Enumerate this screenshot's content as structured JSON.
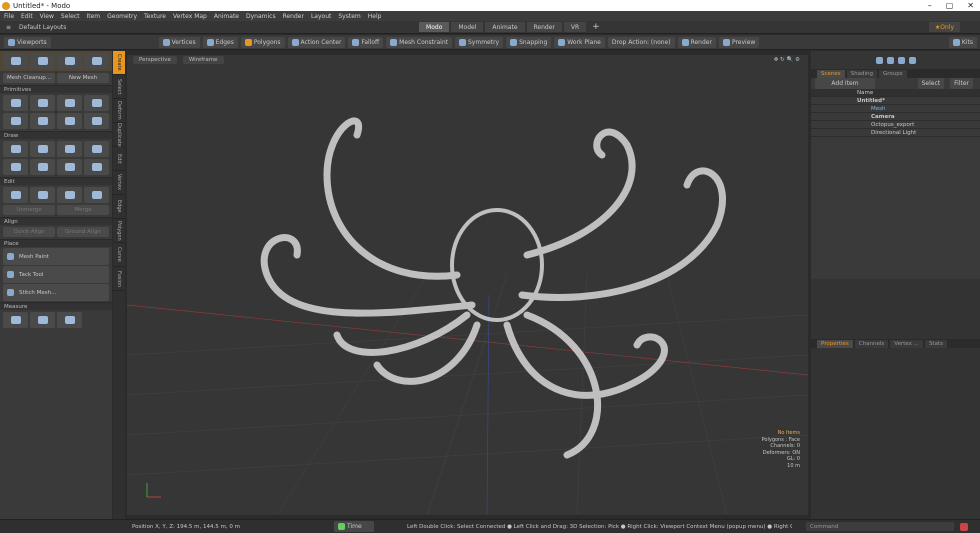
{
  "window": {
    "title": "Untitled* - Modo",
    "min": "–",
    "max": "▢",
    "close": "✕"
  },
  "menu": [
    "File",
    "Edit",
    "View",
    "Select",
    "Item",
    "Geometry",
    "Texture",
    "Vertex Map",
    "Animate",
    "Dynamics",
    "Render",
    "Layout",
    "System",
    "Help"
  ],
  "layouts": {
    "label": "Default Layouts",
    "tabs": [
      "Modo",
      "Model",
      "Animate",
      "Render",
      "VR"
    ],
    "add": "+",
    "only": "Only"
  },
  "toolbar": {
    "viewports": "Viewports",
    "items": [
      "Vertices",
      "Edges",
      "Polygons",
      "Action Center",
      "Falloff",
      "Mesh Constraint",
      "Symmetry",
      "Snapping",
      "Work Plane",
      "Drop Action: (none)",
      "Render",
      "Preview",
      "Kits"
    ]
  },
  "leftpanel": {
    "cleanup": "Mesh Cleanup...",
    "newmesh": "New Mesh",
    "primitives": "Primitives",
    "draw": "Draw",
    "edit": "Edit",
    "unmerge": "Unmerge",
    "merge": "Merge",
    "align": "Align",
    "quickalign": "Quick Align",
    "groundalign": "Ground Align",
    "place": "Place",
    "meshpaint": "Mesh Paint",
    "tacktool": "Tack Tool",
    "stitchmesh": "Stitch Mesh...",
    "measure": "Measure"
  },
  "vtabs": [
    "Create",
    "Select",
    "Deform",
    "Duplicate",
    "Edit",
    "Vertex",
    "Edge",
    "Polygon",
    "Curve",
    "Fusion"
  ],
  "viewport": {
    "view": "Perspective",
    "shading": "Wireframe",
    "hud": [
      "No Items",
      "Polygons : Face",
      "Channels: 0",
      "Deformers: ON",
      "GL: 0",
      "10 m"
    ]
  },
  "scene": {
    "tabs": [
      "Scenes",
      "Shading",
      "Groups"
    ],
    "add_item": "Add Item",
    "select": "Select",
    "filter": "Filter",
    "name_col": "Name",
    "items": [
      "Untitled*",
      "Mesh",
      "Camera",
      "Octopus_export",
      "Directional Light"
    ]
  },
  "props": {
    "tabs": [
      "Properties",
      "Channels",
      "Vertex ...",
      "Stats"
    ]
  },
  "status": {
    "position": "Position X, Y, Z:  194.5 m, 144.5 m, 0 m",
    "time": "Time",
    "hint": "Left Double Click: Select Connected ● Left Click and Drag: 3D Selection: Pick ● Right Click: Viewport Context Menu (popup menu) ● Right Click and Dra...",
    "command": "Command"
  }
}
